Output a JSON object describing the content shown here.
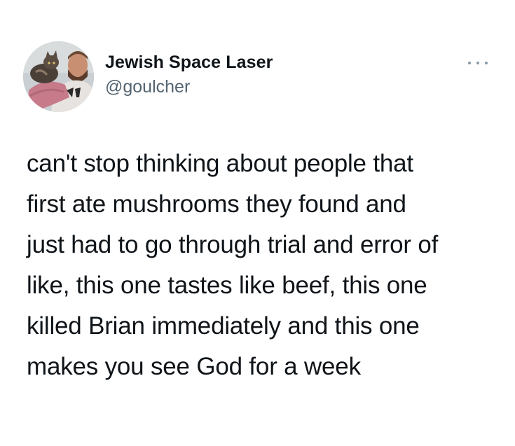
{
  "tweet": {
    "display_name": "Jewish Space Laser",
    "handle": "@goulcher",
    "more_icon": "more-horizontal-icon",
    "avatar": "avatar-photo",
    "text_lines": [
      "can't stop thinking about people that",
      "first ate mushrooms they found and",
      "just had to go through trial and error of",
      "like, this one tastes like beef, this one",
      "killed Brian immediately and this one",
      "makes you see God for a week"
    ]
  }
}
